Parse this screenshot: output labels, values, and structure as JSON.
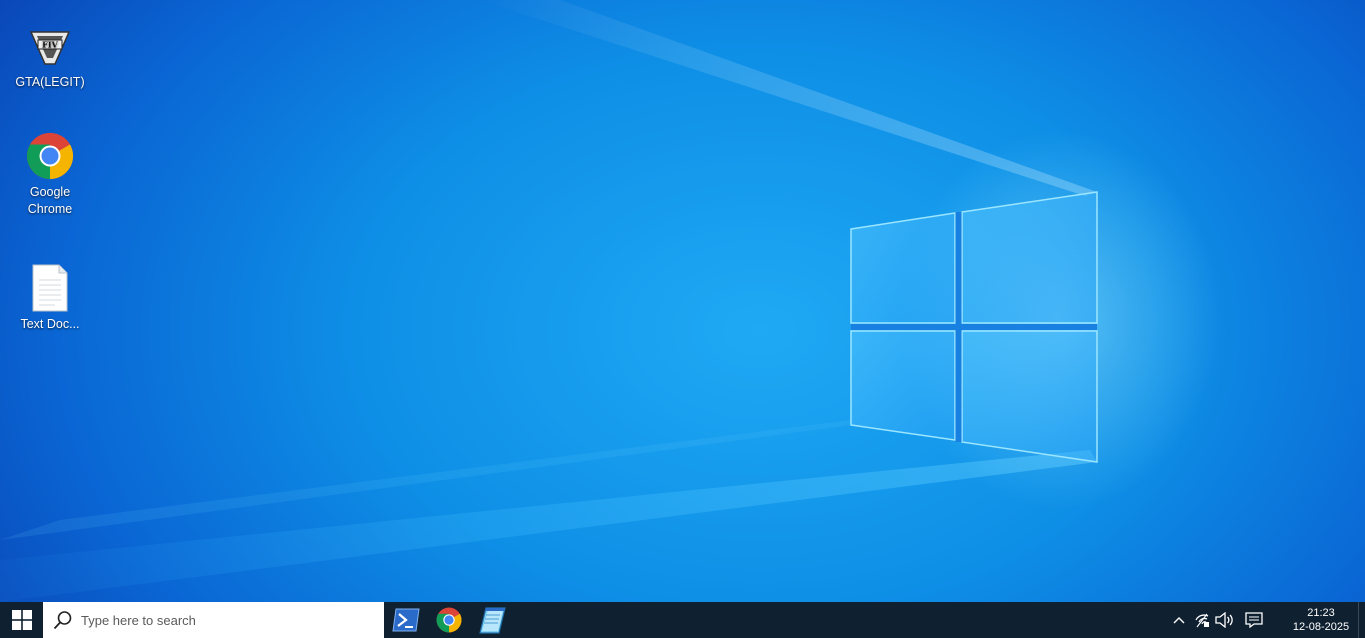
{
  "desktop": {
    "icons": [
      {
        "label": "GTA(LEGIT)",
        "icon": "gta-v-icon"
      },
      {
        "label": "Google Chrome",
        "icon": "chrome-icon"
      },
      {
        "label": "Text Doc...",
        "icon": "text-document-icon"
      }
    ]
  },
  "taskbar": {
    "start_icon": "windows-logo-icon",
    "search": {
      "placeholder": "Type here to search",
      "icon": "search-icon"
    },
    "apps": [
      {
        "name": "PowerShell",
        "icon": "powershell-icon"
      },
      {
        "name": "Google Chrome",
        "icon": "chrome-icon"
      },
      {
        "name": "Notepad",
        "icon": "notepad-icon"
      }
    ],
    "tray": {
      "icons": [
        "chevron-up-icon",
        "network-icon",
        "volume-icon",
        "notifications-icon"
      ],
      "time": "21:23",
      "date": "12-08-2025"
    }
  },
  "colors": {
    "taskbar": "#0f2030",
    "wallpaper_accent": "#1fa9f4",
    "wallpaper_dark": "#0a47b8"
  }
}
